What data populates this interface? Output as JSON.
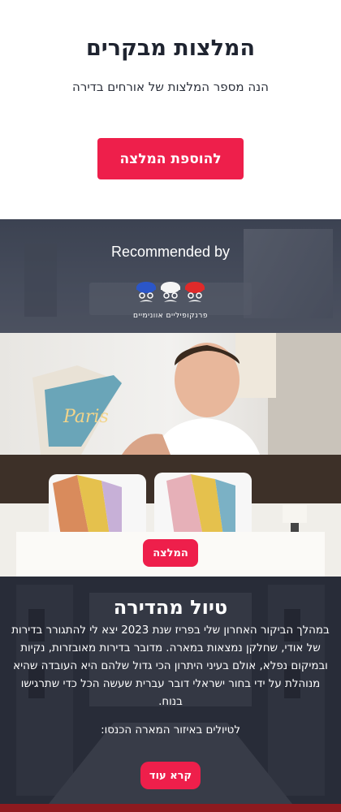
{
  "header": {
    "title": "המלצות מבקרים",
    "subtitle": "הנה מספר המלצות של אורחים בדירה",
    "add_button_label": "להוספת המלצה"
  },
  "recommended_banner": {
    "label": "Recommended by",
    "logo_caption": "פרנקופיליים אוונימיים"
  },
  "recommendation_card": {
    "button_label": "המלצה"
  },
  "tour": {
    "title": "טיול מהדירה",
    "body": "במהלך הביקור האחרון שלי בפריז שנת 2023 יצא לי להתגורר בדירות של אודי, שחלקן נמצאות במארה. מדובר בדירות מאובזרות, נקיות ובמיקום נפלא, אולם בעיני היתרון הכי גדול שלהם היא העובדה שהיא מנוהלת על ידי בחור ישראלי דובר עברית שעשה הכל כדי שתרגישו בנוח.",
    "subtext": "לטיולים באיזור המארה הכנסו:",
    "read_more_label": "קרא עוד"
  },
  "colors": {
    "accent": "#ee1f4b",
    "dark_red_strip": "#8e1a1f"
  }
}
